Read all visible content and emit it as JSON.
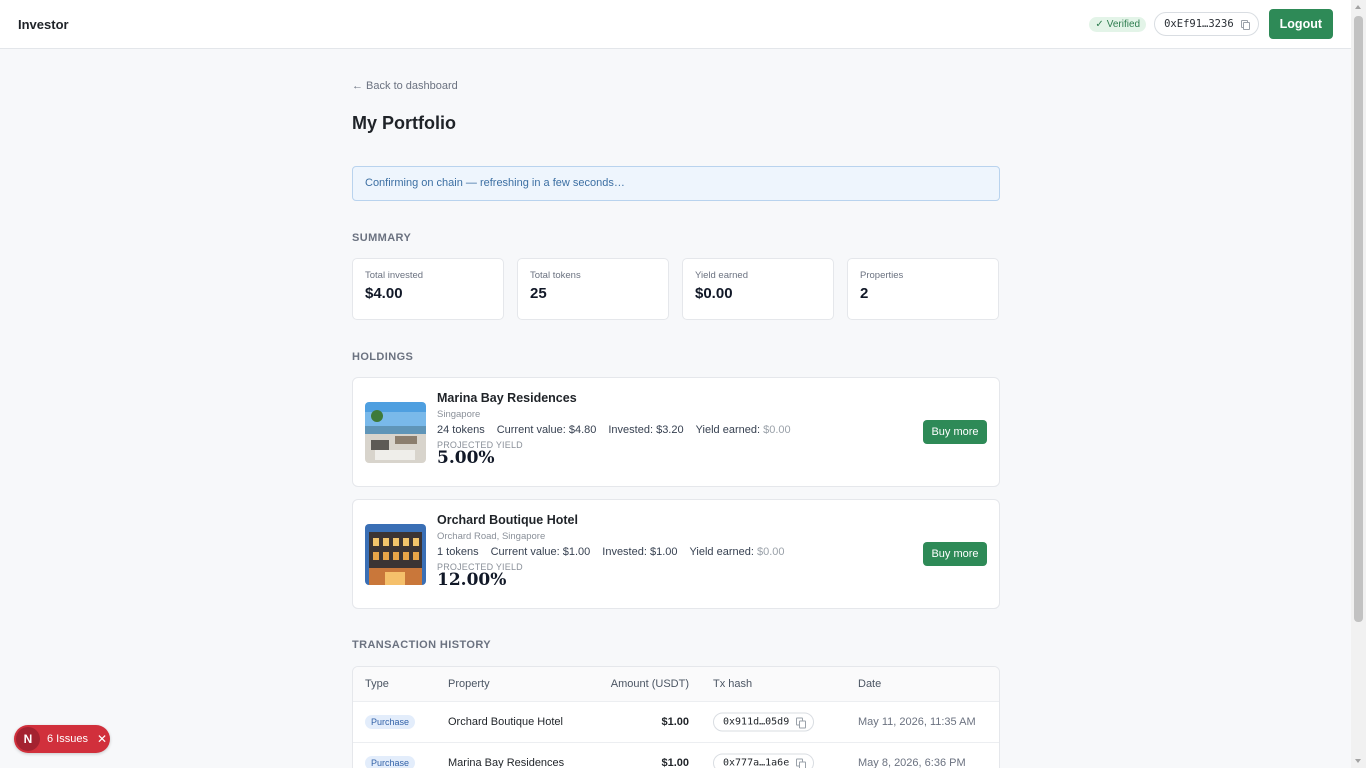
{
  "topbar": {
    "brand": "Investor",
    "verified": "Verified",
    "wallet": "0xEf91…3236",
    "logout": "Logout"
  },
  "page": {
    "back": "← Back to dashboard",
    "title": "My Portfolio",
    "notice": "Confirming on chain — refreshing in a few seconds…"
  },
  "summary": {
    "label": "SUMMARY",
    "cards": [
      {
        "label": "Total invested",
        "value": "$4.00"
      },
      {
        "label": "Total tokens",
        "value": "25"
      },
      {
        "label": "Yield earned",
        "value": "$0.00"
      },
      {
        "label": "Properties",
        "value": "2"
      }
    ]
  },
  "holdings": {
    "label": "HOLDINGS",
    "items": [
      {
        "name": "Marina Bay Residences",
        "location": "Singapore",
        "tokens": "24 tokens",
        "current_value": "Current value: $4.80",
        "invested": "Invested: $3.20",
        "yield_label": "Yield earned:",
        "yield_value": "$0.00",
        "projected_label": "PROJECTED YIELD",
        "projected_value": "5.00%",
        "button": "Buy more"
      },
      {
        "name": "Orchard Boutique Hotel",
        "location": "Orchard Road, Singapore",
        "tokens": "1 tokens",
        "current_value": "Current value: $1.00",
        "invested": "Invested: $1.00",
        "yield_label": "Yield earned:",
        "yield_value": "$0.00",
        "projected_label": "PROJECTED YIELD",
        "projected_value": "12.00%",
        "button": "Buy more"
      }
    ]
  },
  "transactions": {
    "label": "TRANSACTION HISTORY",
    "headers": {
      "type": "Type",
      "property": "Property",
      "amount": "Amount (USDT)",
      "hash": "Tx hash",
      "date": "Date"
    },
    "rows": [
      {
        "type": "Purchase",
        "property": "Orchard Boutique Hotel",
        "amount": "$1.00",
        "hash": "0x911d…05d9",
        "date": "May 11, 2026, 11:35 AM"
      },
      {
        "type": "Purchase",
        "property": "Marina Bay Residences",
        "amount": "$1.00",
        "hash": "0x777a…1a6e",
        "date": "May 8, 2026, 6:36 PM"
      }
    ]
  },
  "devtools": {
    "logo": "N",
    "issues": "6 Issues"
  },
  "colors": {
    "accent": "#2e8a57",
    "notice_bg": "#eef5fd",
    "issues_bg": "#d1303c"
  }
}
